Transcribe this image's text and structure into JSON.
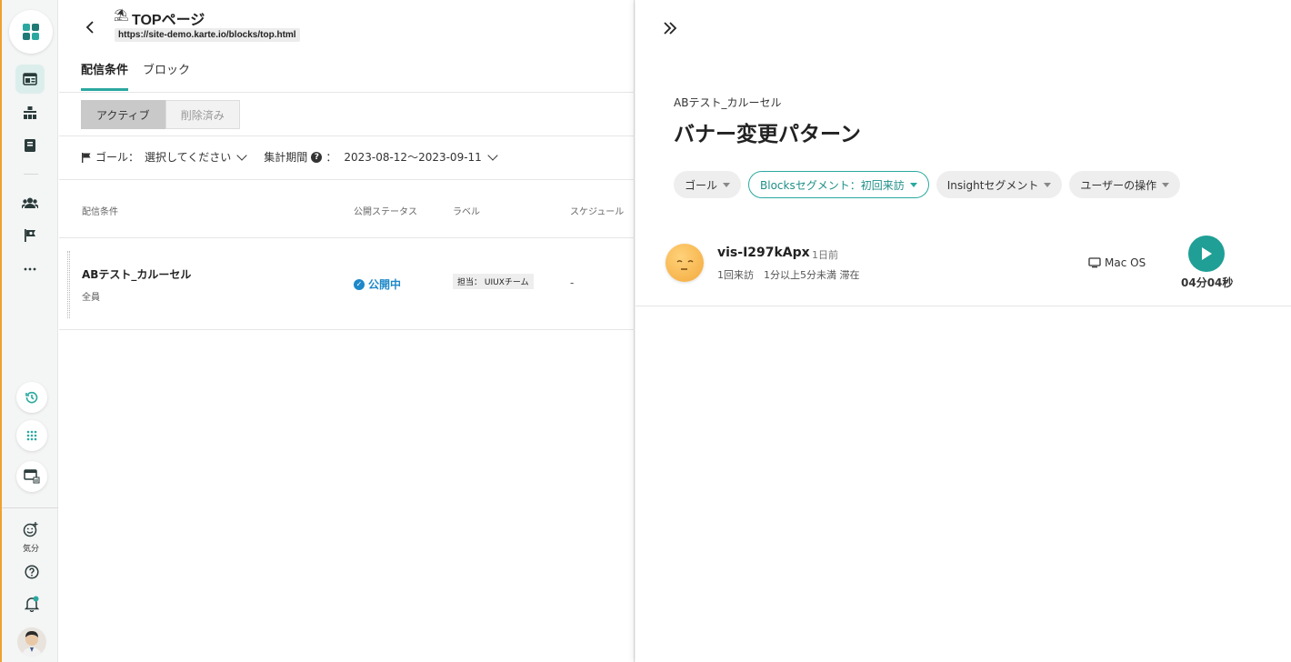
{
  "rail": {
    "kibun_label": "気分"
  },
  "header": {
    "emoji": "⛱",
    "title": "TOPページ",
    "url": "https://site-demo.karte.io/blocks/top.html"
  },
  "tabs": [
    {
      "label": "配信条件"
    },
    {
      "label": "ブロック"
    }
  ],
  "segment": {
    "active_label": "アクティブ",
    "deleted_label": "削除済み"
  },
  "filters": {
    "goal_label": "ゴール：",
    "goal_value": "選択してください",
    "period_label": "集計期間",
    "period_colon": "：",
    "period_value": "2023-08-12〜2023-09-11"
  },
  "table": {
    "headers": [
      "配信条件",
      "公開ステータス",
      "ラベル",
      "スケジュール"
    ],
    "row": {
      "title": "ABテスト_カルーセル",
      "sub": "全員",
      "status": "公開中",
      "label": "担当： UIUXチーム",
      "schedule": "-"
    }
  },
  "detail": {
    "sub_title": "ABテスト_カルーセル",
    "title": "バナー変更パターン",
    "chips": [
      "ゴール",
      "Blocksセグメント：初回来訪",
      "Insightセグメント",
      "ユーザーの操作"
    ],
    "visitor": {
      "id": "vis-I297kApx",
      "time": "1日前",
      "meta": "1回来訪　1分以上5分未満 滞在",
      "os": "Mac OS",
      "duration": "04分04秒"
    }
  },
  "colors": {
    "accent": "#2aa8a0",
    "status_blue": "#1e88c8",
    "rail_border": "#f0a030"
  }
}
